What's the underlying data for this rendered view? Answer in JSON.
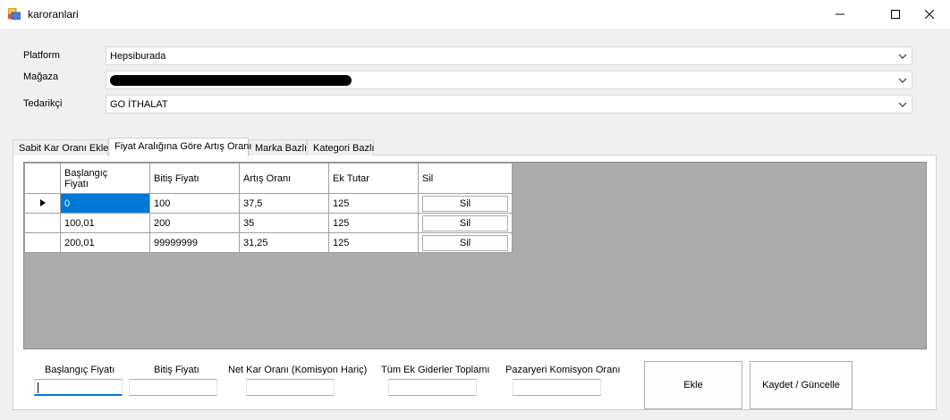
{
  "window": {
    "title": "karoranlari",
    "app_icon": "form-icon",
    "controls": [
      "minimize-icon",
      "maximize-icon",
      "close-icon"
    ]
  },
  "form": {
    "platform_label": "Platform",
    "platform_value": "Hepsiburada",
    "magaza_label": "Mağaza",
    "magaza_value": "",
    "tedarikci_label": "Tedarikçi",
    "tedarikci_value": "GO İTHALAT"
  },
  "tabs": [
    {
      "label": "Sabit Kar Oranı Ekle",
      "active": false
    },
    {
      "label": "Fiyat Aralığına Göre Artış Oranı",
      "active": true
    },
    {
      "label": "Marka Bazlı",
      "active": false
    },
    {
      "label": "Kategori Bazlı",
      "active": false
    }
  ],
  "grid": {
    "columns": [
      "Başlangıç\nFiyatı",
      "Bitiş Fiyatı",
      "Artış Oranı",
      "Ek Tutar",
      "Sil"
    ],
    "rows": [
      {
        "baslangic": "0",
        "bitis": "100",
        "artis": "37,5",
        "ek": "125",
        "sil": "Sil",
        "current": true
      },
      {
        "baslangic": "100,01",
        "bitis": "200",
        "artis": "35",
        "ek": "125",
        "sil": "Sil",
        "current": false
      },
      {
        "baslangic": "200,01",
        "bitis": "99999999",
        "artis": "31,25",
        "ek": "125",
        "sil": "Sil",
        "current": false
      }
    ]
  },
  "inputs": {
    "baslangic_label": "Başlangıç Fiyatı",
    "baslangic_value": "",
    "bitis_label": "Bitiş Fiyatı",
    "bitis_value": "",
    "netkar_label": "Net Kar Oranı (Komisyon Hariç)",
    "netkar_value": "",
    "ekgider_label": "Tüm Ek Giderler Toplamı",
    "ekgider_value": "",
    "komisyon_label": "Pazaryeri Komisyon Oranı",
    "komisyon_value": ""
  },
  "buttons": {
    "ekle": "Ekle",
    "kaydet": "Kaydet / Güncelle"
  },
  "colors": {
    "selection": "#0078d7",
    "grid_background": "#ababab"
  }
}
